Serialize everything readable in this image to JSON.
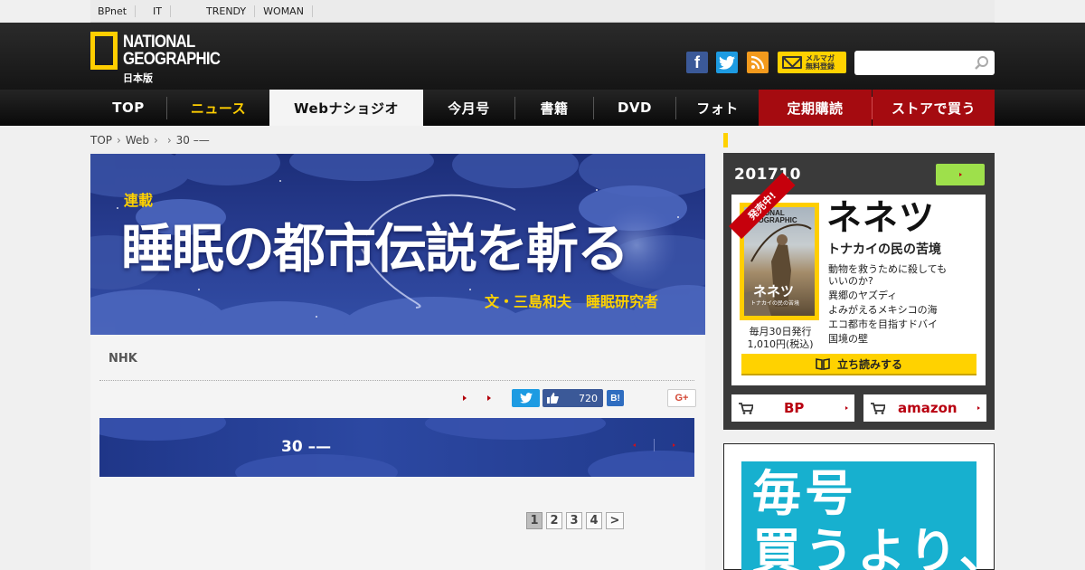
{
  "util_bar": {
    "items": [
      "BPnet",
      "",
      "IT",
      "",
      "",
      "",
      "TRENDY",
      "WOMAN",
      "",
      "",
      ""
    ]
  },
  "header": {
    "logo": {
      "line1": "NATIONAL",
      "line2": "GEOGRAPHIC",
      "line3": "日本版"
    },
    "social": {
      "facebook": "f",
      "rss": "rss"
    },
    "mail": {
      "line1": "メルマガ",
      "line2": "無料登録"
    },
    "search": {
      "placeholder": "",
      "value": ""
    }
  },
  "nav": {
    "items": [
      "TOP",
      "ニュース",
      "Webナショジオ",
      "今月号",
      "書籍",
      "DVD",
      "フォト",
      "定期購読",
      "ストアで買う"
    ]
  },
  "breadcrumb": [
    "TOP",
    "Web",
    "",
    "30 –—"
  ],
  "hero": {
    "tag": "連載",
    "title": "睡眠の都市伝説を斬る",
    "byline": "文・三島和夫　睡眠研究者"
  },
  "article": {
    "author": "NHK",
    "share": {
      "facebook_count": "720",
      "hatena": "B!",
      "gplus": "G+"
    },
    "band_title": "30 –—",
    "pagination": [
      "1",
      "2",
      "3",
      "4",
      ">"
    ]
  },
  "sidebar": {
    "magazine": {
      "issue": "201710",
      "ribbon": "発売中!",
      "cover_title": "ネネツ",
      "cover_sub": "トナカイの民の苦境",
      "headline": "ネネツ",
      "subtitle": "トナカイの民の苦境",
      "items": [
        "動物を救うために殺しても",
        "いいのか?",
        "異郷のヤズディ",
        "よみがえるメキシコの海",
        "エコ都市を目指すドバイ",
        "国境の壁"
      ],
      "price_line1": "毎月30日発行",
      "price_line2": "1,010円(税込)",
      "read_button": "立ち読みする",
      "buy_buttons": [
        "BP",
        "amazon"
      ]
    },
    "ad": {
      "line1": "毎号",
      "line2": "買うより、"
    }
  }
}
